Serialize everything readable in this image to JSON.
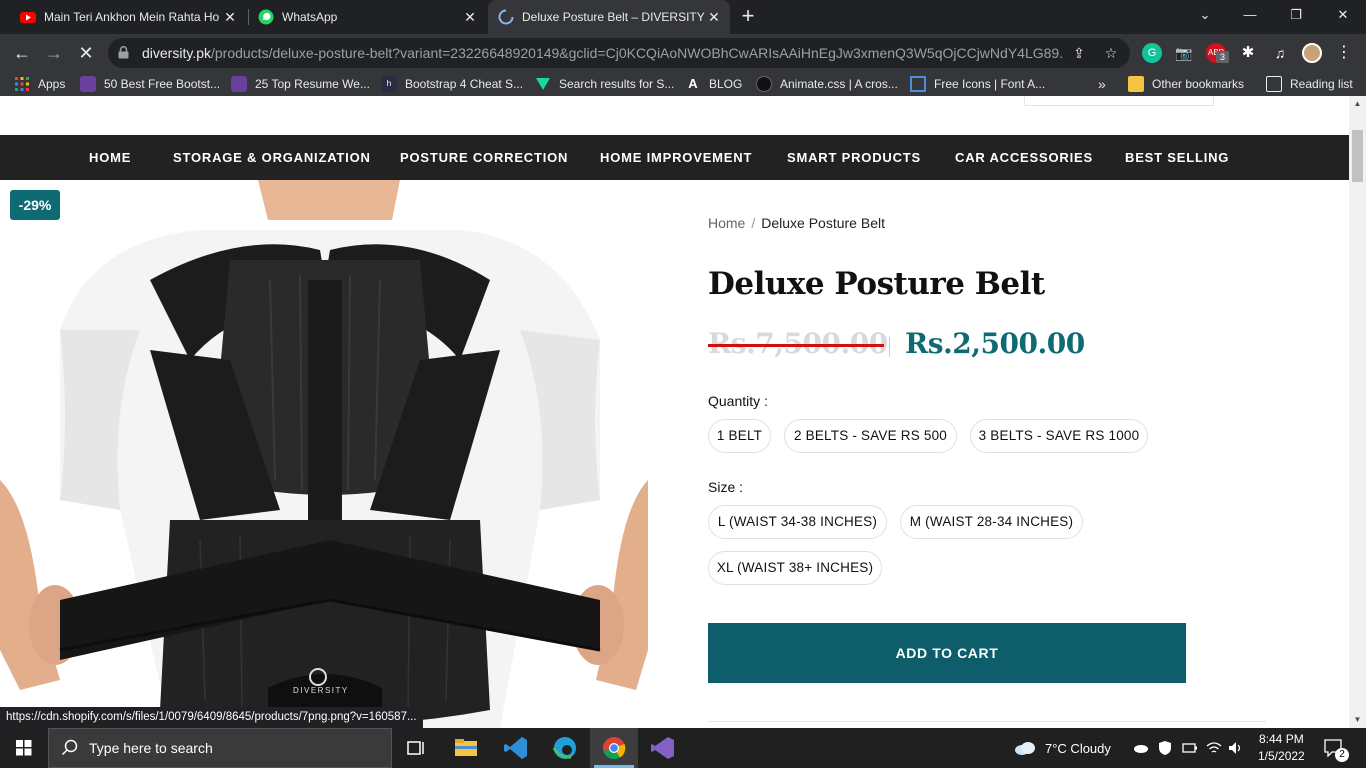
{
  "browser": {
    "tabs": [
      {
        "title": "Main Teri Ankhon Mein Rahta Ho",
        "icon": "youtube-icon"
      },
      {
        "title": "WhatsApp",
        "icon": "whatsapp-icon"
      },
      {
        "title": "Deluxe Posture Belt – DIVERSITY",
        "icon": "loading-spinner-icon",
        "active": true
      }
    ],
    "url_host": "diversity.pk",
    "url_path": "/products/deluxe-posture-belt?variant=23226648920149&gclid=Cj0KCQiAoNWOBhCwARIsAAiHnEgJw3xmenQ3W5qOjCCjwNdY4LG89...",
    "extension_badge": "3",
    "bookmarks": [
      {
        "label": "Apps"
      },
      {
        "label": "50 Best Free Bootst..."
      },
      {
        "label": "25 Top Resume We..."
      },
      {
        "label": "Bootstrap 4 Cheat S..."
      },
      {
        "label": "Search results for S..."
      },
      {
        "label": "BLOG"
      },
      {
        "label": "Animate.css | A cros..."
      },
      {
        "label": "Free Icons | Font A..."
      }
    ],
    "bookmarks_overflow": "»",
    "other_bookmarks": "Other bookmarks",
    "reading_list": "Reading list",
    "status_url": "https://cdn.shopify.com/s/files/1/0079/6409/8645/products/7png.png?v=160587..."
  },
  "nav": {
    "items": [
      "HOME",
      "STORAGE & ORGANIZATION",
      "POSTURE CORRECTION",
      "HOME IMPROVEMENT",
      "SMART PRODUCTS",
      "CAR ACCESSORIES",
      "BEST SELLING"
    ]
  },
  "product": {
    "badge": "-29%",
    "breadcrumb_home": "Home",
    "breadcrumb_sep": "/",
    "breadcrumb_current": "Deluxe Posture Belt",
    "title": "Deluxe Posture Belt",
    "old_price": "Rs.7,500.00",
    "new_price": "Rs.2,500.00",
    "quantity_label": "Quantity :",
    "quantity_options": [
      "1 BELT",
      "2 BELTS - SAVE RS 500",
      "3 BELTS - SAVE RS 1000"
    ],
    "size_label": "Size :",
    "size_options": [
      "L (WAIST 34-38 INCHES)",
      "M (WAIST 28-34 INCHES)",
      "XL (WAIST 38+ INCHES)"
    ],
    "add_to_cart": "ADD TO CART",
    "brand_on_image": "DIVERSITY"
  },
  "colors": {
    "accent_teal": "#0f6b73",
    "cart_button": "#0d5d6b",
    "nav_bg": "#222222",
    "strike_red": "#d01010"
  },
  "taskbar": {
    "search_placeholder": "Type here to search",
    "weather": "7°C  Cloudy",
    "time": "8:44 PM",
    "date": "1/5/2022",
    "notifications": "2"
  }
}
